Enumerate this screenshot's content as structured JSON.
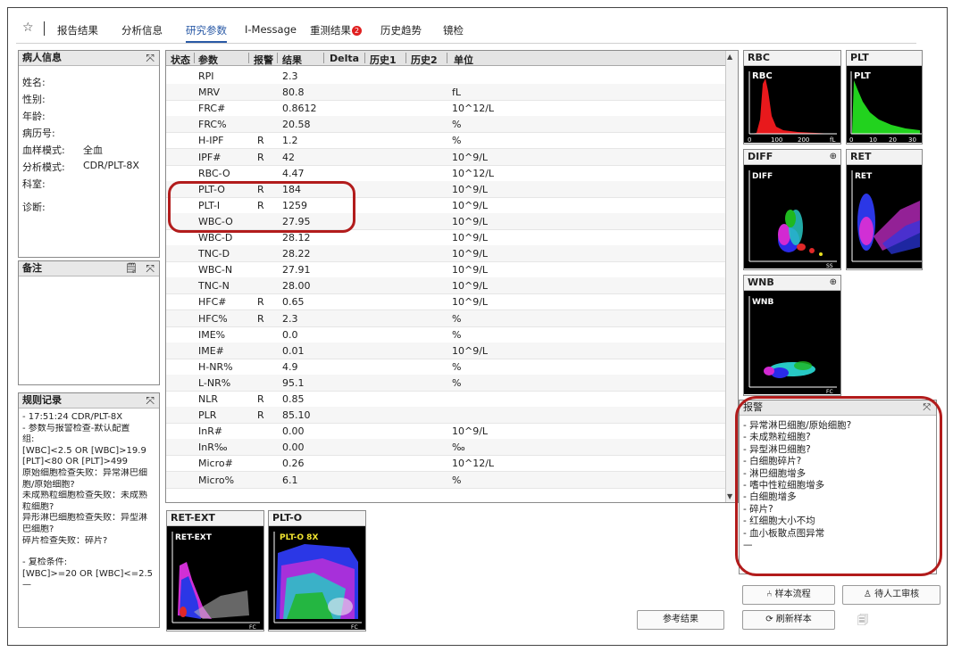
{
  "tabs": [
    {
      "label": "报告结果"
    },
    {
      "label": "分析信息"
    },
    {
      "label": "研究参数",
      "active": true
    },
    {
      "label": "I-Message"
    },
    {
      "label": "重测结果",
      "badge": "2"
    },
    {
      "label": "历史趋势"
    },
    {
      "label": "镜检"
    }
  ],
  "patient": {
    "title": "病人信息",
    "fields": [
      {
        "label": "姓名:",
        "value": ""
      },
      {
        "label": "性别:",
        "value": ""
      },
      {
        "label": "年龄:",
        "value": ""
      },
      {
        "label": "病历号:",
        "value": ""
      },
      {
        "label": "血样模式:",
        "value": "全血"
      },
      {
        "label": "分析模式:",
        "value": "CDR/PLT-8X"
      },
      {
        "label": "科室:",
        "value": ""
      },
      {
        "label": "诊断:",
        "value": ""
      }
    ]
  },
  "notes": {
    "title": "备注"
  },
  "rules": {
    "title": "规则记录",
    "lines": [
      "- 17:51:24 CDR/PLT-8X",
      "- 参数与报警检查-默认配置",
      "组:",
      "[WBC]<2.5 OR [WBC]>19.9",
      "[PLT]<80 OR [PLT]>499",
      "原始细胞检查失败：异常淋巴细",
      "胞/原始细胞?",
      "未成熟粒细胞检查失败：未成熟",
      "粒细胞?",
      "异形淋巴细胞检查失败：异型淋",
      "巴细胞?",
      "碎片检查失败：碎片?",
      "",
      "- 复检条件:",
      "[WBC]>=20 OR [WBC]<=2.5",
      "—"
    ]
  },
  "table": {
    "headers": [
      "状态",
      "参数",
      "报警",
      "结果",
      "Delta",
      "历史1",
      "历史2",
      "单位"
    ],
    "rows": [
      {
        "param": "RPI",
        "flag": "",
        "result": "2.3",
        "unit": ""
      },
      {
        "param": "MRV",
        "flag": "",
        "result": "80.8",
        "unit": "fL"
      },
      {
        "param": "FRC#",
        "flag": "",
        "result": "0.8612",
        "unit": "10^12/L"
      },
      {
        "param": "FRC%",
        "flag": "",
        "result": "20.58",
        "unit": "%"
      },
      {
        "param": "H-IPF",
        "flag": "R",
        "result": "1.2",
        "unit": "%"
      },
      {
        "param": "IPF#",
        "flag": "R",
        "result": "42",
        "unit": "10^9/L"
      },
      {
        "param": "RBC-O",
        "flag": "",
        "result": "4.47",
        "unit": "10^12/L"
      },
      {
        "param": "PLT-O",
        "flag": "R",
        "result": "184",
        "unit": "10^9/L"
      },
      {
        "param": "PLT-I",
        "flag": "R",
        "result": "1259",
        "unit": "10^9/L"
      },
      {
        "param": "WBC-O",
        "flag": "",
        "result": "27.95",
        "unit": "10^9/L"
      },
      {
        "param": "WBC-D",
        "flag": "",
        "result": "28.12",
        "unit": "10^9/L"
      },
      {
        "param": "TNC-D",
        "flag": "",
        "result": "28.22",
        "unit": "10^9/L"
      },
      {
        "param": "WBC-N",
        "flag": "",
        "result": "27.91",
        "unit": "10^9/L"
      },
      {
        "param": "TNC-N",
        "flag": "",
        "result": "28.00",
        "unit": "10^9/L"
      },
      {
        "param": "HFC#",
        "flag": "R",
        "result": "0.65",
        "unit": "10^9/L"
      },
      {
        "param": "HFC%",
        "flag": "R",
        "result": "2.3",
        "unit": "%"
      },
      {
        "param": "IME%",
        "flag": "",
        "result": "0.0",
        "unit": "%"
      },
      {
        "param": "IME#",
        "flag": "",
        "result": "0.01",
        "unit": "10^9/L"
      },
      {
        "param": "H-NR%",
        "flag": "",
        "result": "4.9",
        "unit": "%"
      },
      {
        "param": "L-NR%",
        "flag": "",
        "result": "95.1",
        "unit": "%"
      },
      {
        "param": "NLR",
        "flag": "R",
        "result": "0.85",
        "unit": ""
      },
      {
        "param": "PLR",
        "flag": "R",
        "result": "85.10",
        "unit": ""
      },
      {
        "param": "InR#",
        "flag": "",
        "result": "0.00",
        "unit": "10^9/L"
      },
      {
        "param": "InR‰",
        "flag": "",
        "result": "0.00",
        "unit": "‰"
      },
      {
        "param": "Micro#",
        "flag": "",
        "result": "0.26",
        "unit": "10^12/L"
      },
      {
        "param": "Micro%",
        "flag": "",
        "result": "6.1",
        "unit": "%"
      }
    ]
  },
  "graphs": {
    "rbc": {
      "title": "RBC",
      "inner": "RBC",
      "ticks": [
        "0",
        "100",
        "200",
        "fL"
      ]
    },
    "plt": {
      "title": "PLT",
      "inner": "PLT",
      "ticks": [
        "0",
        "10",
        "20",
        "30"
      ]
    },
    "diff": {
      "title": "DIFF",
      "inner": "DIFF",
      "axis": "SS"
    },
    "ret": {
      "title": "RET",
      "inner": "RET"
    },
    "wnb": {
      "title": "WNB",
      "inner": "WNB",
      "axis": "FC"
    },
    "retext": {
      "title": "RET-EXT",
      "inner": "RET-EXT",
      "axis": "FC"
    },
    "plto": {
      "title": "PLT-O",
      "inner": "PLT-O 8X",
      "axis": "FC"
    }
  },
  "alarms": {
    "title": "报警",
    "items": [
      "- 异常淋巴细胞/原始细胞?",
      "- 未成熟粒细胞?",
      "- 异型淋巴细胞?",
      "- 白细胞碎片?",
      "- 淋巴细胞增多",
      "- 嗜中性粒细胞增多",
      "- 白细胞增多",
      "- 碎片?",
      "- 红细胞大小不均",
      "- 血小板散点图异常",
      "—"
    ]
  },
  "buttons": {
    "reference": "参考结果",
    "sample_flow": "样本流程",
    "manual_review": "待人工审核",
    "refresh_sample": "刷新样本"
  },
  "colors": {
    "accent": "#2a5aa6",
    "highlight": "#b21c1c",
    "badge": "#e02020"
  }
}
